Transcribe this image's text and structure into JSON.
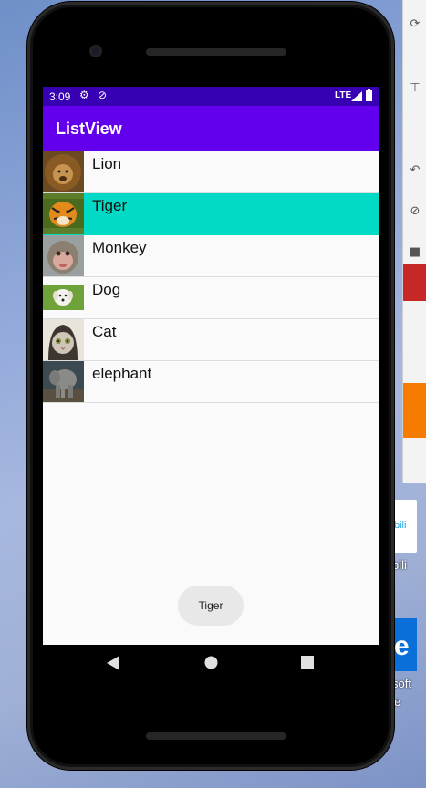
{
  "app": {
    "title": "ListView"
  },
  "status_bar": {
    "time": "3:09",
    "network": "LTE"
  },
  "list": {
    "items": [
      {
        "label": "Lion",
        "icon": "lion-photo",
        "selected": false
      },
      {
        "label": "Tiger",
        "icon": "tiger-photo",
        "selected": true
      },
      {
        "label": "Monkey",
        "icon": "monkey-photo",
        "selected": false
      },
      {
        "label": "Dog",
        "icon": "dog-photo",
        "selected": false
      },
      {
        "label": "Cat",
        "icon": "cat-photo",
        "selected": false
      },
      {
        "label": "elephant",
        "icon": "elephant-photo",
        "selected": false
      }
    ]
  },
  "toast": {
    "text": "Tiger"
  },
  "desktop": {
    "bili_label": "bili",
    "edge_label": "soft",
    "edge_label2": "e"
  },
  "colors": {
    "status_bar": "#3700b3",
    "app_bar": "#6200ee",
    "selected_row": "#03dac5"
  }
}
